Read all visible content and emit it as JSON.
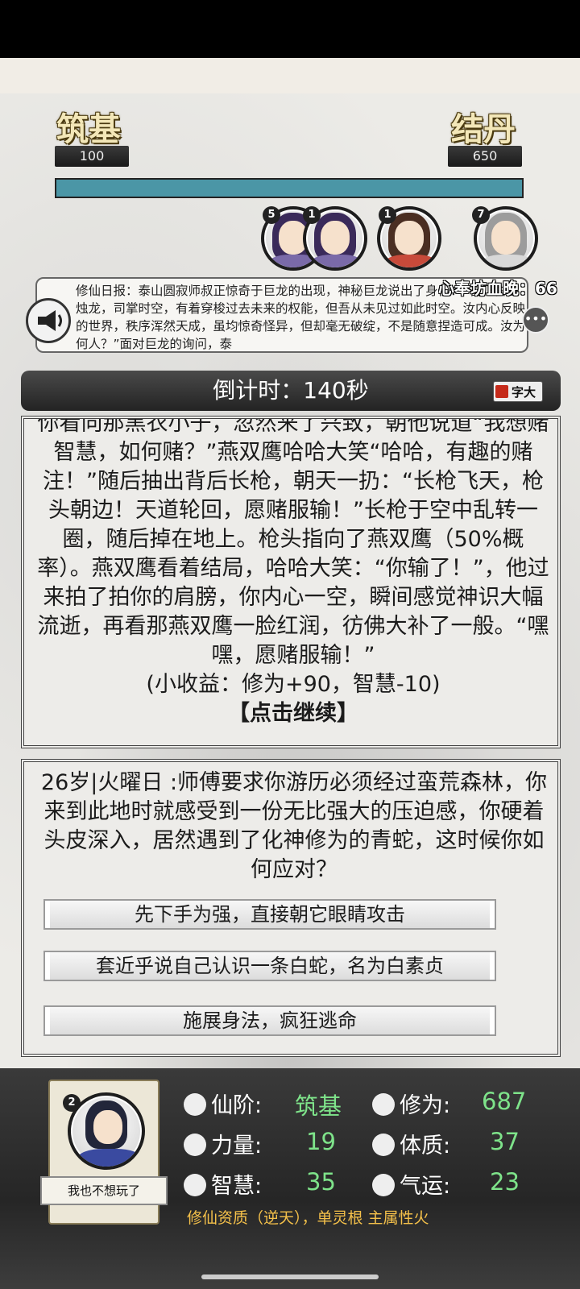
{
  "header": {
    "realm_current": "筑基",
    "realm_current_value": "100",
    "realm_next": "结丹",
    "realm_next_value": "650",
    "progress_fraction": 1.0
  },
  "players": [
    {
      "badge": "5",
      "hair": "#3a2a5a",
      "robe": "#7a6aa8"
    },
    {
      "badge": "1",
      "hair": "#3a2a5a",
      "robe": "#7a6aa8"
    },
    {
      "badge": "1",
      "hair": "#4a2e22",
      "robe": "#c84a3a"
    },
    {
      "badge": "7",
      "hair": "#9c9c9c",
      "robe": "#d8d8d8"
    }
  ],
  "scroller_name": "心奉坊血晚：66",
  "news": {
    "text": "修仙日报：泰山圆寂师叔正惊奇于巨龙的出现，神秘巨龙说出了身份：“吾乃古兽烛龙，司掌时空，有着穿梭过去未来的权能，但吾从未见过如此时空。汝内心反映的世界，秩序浑然天成，虽均惊奇怪异，但却毫无破绽，不是随意捏造可成。汝为何人？”面对巨龙的询问，泰"
  },
  "countdown": "倒计时：140秒",
  "font_button": "字大",
  "story": {
    "text": "你看向那黑衣小子，忽然来了兴致，朝他说道“我想赌智慧，如何赌？”燕双鹰哈哈大笑“哈哈，有趣的赌注！”随后抽出背后长枪，朝天一扔：“长枪飞天，枪头朝边！天道轮回，愿赌服输！”长枪于空中乱转一圈，随后掉在地上。枪头指向了燕双鹰（50%概率）。燕双鹰看着结局，哈哈大笑：“你输了！”，他过来拍了拍你的肩膀，你内心一空，瞬间感觉神识大幅流逝，再看那燕双鹰一脸红润，彷佛大补了一般。“嘿嘿，愿赌服输！”",
    "reward": "(小收益：修为+90，智慧-10)",
    "continue": "【点击继续】"
  },
  "event": {
    "text": "26岁|火曜日 :师傅要求你游历必须经过蛮荒森林，你来到此地时就感受到一份无比强大的压迫感，你硬着头皮深入，居然遇到了化神修为的青蛇，这时候你如何应对？",
    "choices": [
      "先下手为强，直接朝它眼睛攻击",
      "套近乎说自己认识一条白蛇，名为白素贞",
      "施展身法，疯狂逃命"
    ]
  },
  "character": {
    "badge": "2",
    "name": "我也不想玩了",
    "stats": {
      "realm_label": "仙阶:",
      "realm_value": "筑基",
      "cultivation_label": "修为:",
      "cultivation_value": "687",
      "strength_label": "力量:",
      "strength_value": "19",
      "constitution_label": "体质:",
      "constitution_value": "37",
      "wisdom_label": "智慧:",
      "wisdom_value": "35",
      "luck_label": "气运:",
      "luck_value": "23"
    },
    "aptitude": "修仙资质（逆天），单灵根 主属性火"
  },
  "colors": {
    "progress": "#5aa1ad",
    "stat_value": "#7ee38a",
    "aptitude": "#f5c14a"
  }
}
